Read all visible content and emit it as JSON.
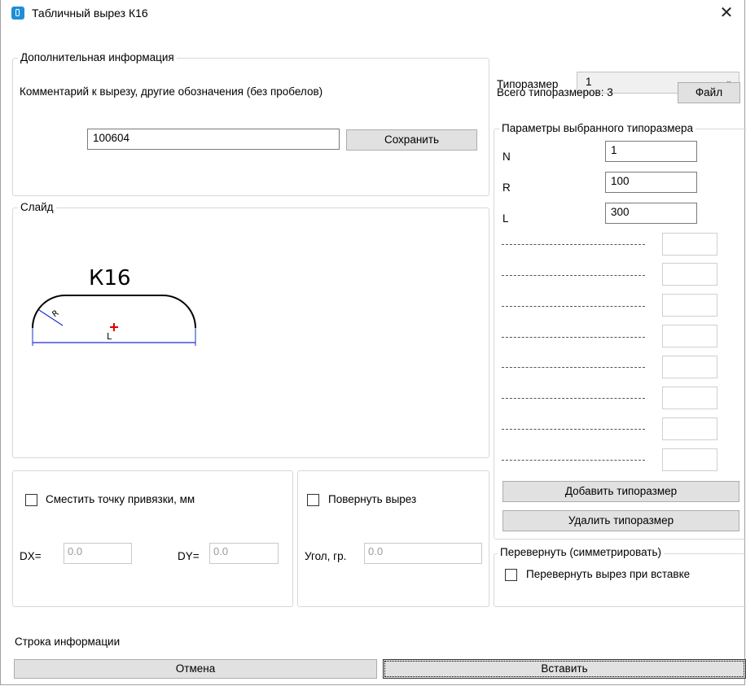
{
  "window": {
    "title": "Табличный вырез  К16",
    "close_glyph": "✕"
  },
  "extra_info": {
    "legend": "Дополнительная информация",
    "comment_label": "Комментарий к вырезу, другие обозначения (без пробелов)",
    "comment_value": "100604",
    "save_label": "Сохранить"
  },
  "slide": {
    "legend": "Слайд",
    "shape_name": "К16",
    "r_label": "R",
    "l_label": "L",
    "colors": {
      "outline": "#000000",
      "dimension": "#1a2fd6",
      "anchor": "#e00000"
    }
  },
  "offset": {
    "checkbox_label": "Сместить точку привязки, мм",
    "dx_label": "DX=",
    "dx_value": "0.0",
    "dy_label": "DY=",
    "dy_value": "0.0"
  },
  "rotate": {
    "checkbox_label": "Повернуть вырез",
    "angle_label": "Угол, гр.",
    "angle_value": "0.0"
  },
  "size": {
    "label": "Типоразмер",
    "selected": "1",
    "total_label": "Всего типоразмеров: 3",
    "file_label": "Файл"
  },
  "params": {
    "legend": "Параметры выбранного типоразмера",
    "rows": [
      {
        "name": "N",
        "value": "1"
      },
      {
        "name": "R",
        "value": "100"
      },
      {
        "name": "L",
        "value": "300"
      }
    ],
    "empty_row_count": 8,
    "add_label": "Добавить типоразмер",
    "delete_label": "Удалить типоразмер"
  },
  "flip": {
    "legend": "Перевернуть (симметрировать)",
    "checkbox_label": "Перевернуть вырез при вставке"
  },
  "footer": {
    "info_label": "Строка информации",
    "cancel_label": "Отмена",
    "insert_label": "Вставить"
  }
}
